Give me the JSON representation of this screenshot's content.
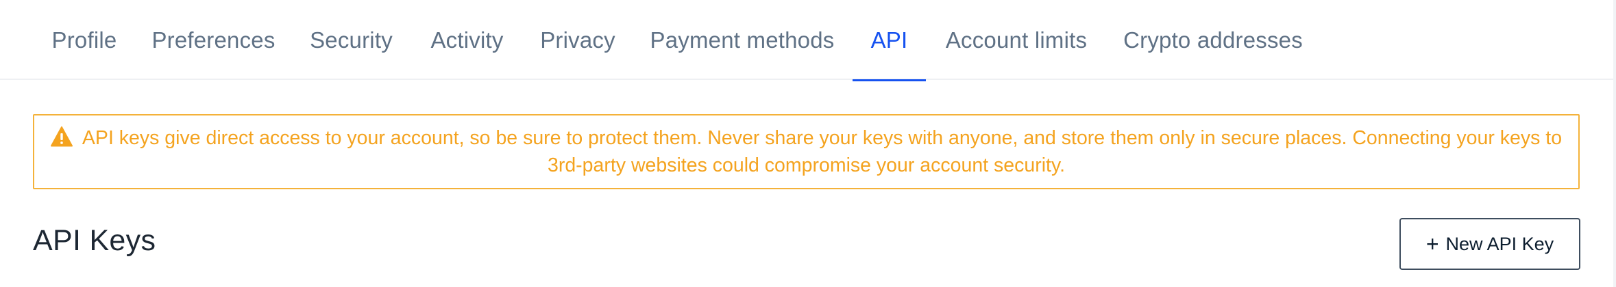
{
  "tabs": [
    {
      "label": "Profile",
      "active": false
    },
    {
      "label": "Preferences",
      "active": false
    },
    {
      "label": "Security",
      "active": false
    },
    {
      "label": "Activity",
      "active": false
    },
    {
      "label": "Privacy",
      "active": false
    },
    {
      "label": "Payment methods",
      "active": false
    },
    {
      "label": "API",
      "active": true
    },
    {
      "label": "Account limits",
      "active": false
    },
    {
      "label": "Crypto addresses",
      "active": false
    }
  ],
  "warning": {
    "icon": "warning-triangle-icon",
    "line1": "API keys give direct access to your account, so be sure to protect them. Never share your keys with anyone, and store them only in secure places. Connecting your keys to",
    "line2": "3rd-party websites could compromise your account security."
  },
  "section": {
    "title": "API Keys",
    "new_key_button": {
      "icon": "+",
      "label": "New API Key"
    }
  },
  "colors": {
    "accent": "#1652f0",
    "tab_text": "#5f7185",
    "warning": "#f4a31f",
    "warning_border": "#f4b23a"
  }
}
